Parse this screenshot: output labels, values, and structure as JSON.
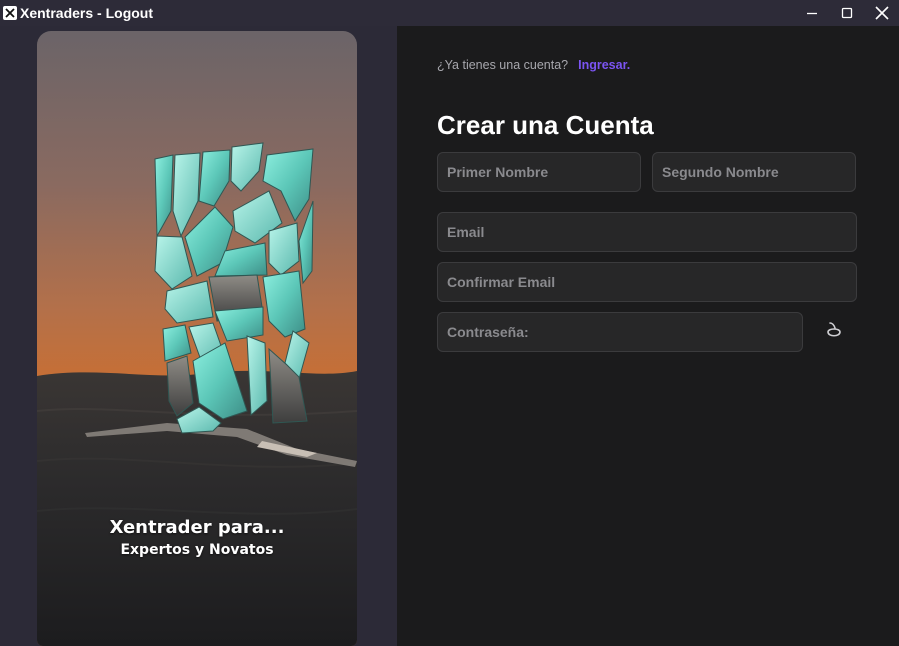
{
  "window": {
    "title": "Xentraders - Logout",
    "app_icon": "x-logo-icon",
    "controls": [
      "minimize-icon",
      "maximize-icon",
      "close-icon"
    ]
  },
  "hero": {
    "tagline_main": "Xentrader para...",
    "tagline_sub": "Expertos y Novatos"
  },
  "form": {
    "login_prompt": "¿Ya tienes una cuenta?",
    "login_link": "Ingresar.",
    "title": "Crear una Cuenta",
    "first_name_placeholder": "Primer Nombre",
    "second_name_placeholder": "Segundo Nombre",
    "email_placeholder": "Email",
    "confirm_email_placeholder": "Confirmar Email",
    "password_placeholder": "Contraseña:",
    "password_toggle_icon": "eye-toggle-icon"
  },
  "colors": {
    "accent": "#7b54f2",
    "panel_bg": "#1b1b1c",
    "field_bg": "#272728",
    "sidebar_bg": "#2c2a37"
  }
}
